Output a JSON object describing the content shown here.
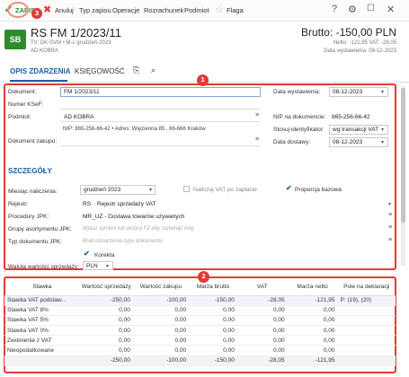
{
  "toolbar": {
    "save": "ZAPISZ",
    "cancel": "Anuluj",
    "type": "Typ zapisu",
    "operations": "Operacje",
    "settlement": "Rozrachunek",
    "subject": "Podmiot",
    "flag": "Flaga",
    "help": "?",
    "markers": {
      "one": "1",
      "two": "2",
      "three": "3"
    }
  },
  "header": {
    "badge": "SB",
    "title": "RS FM 1/2023/11",
    "sub1": "TV: DK-SVM  •  M-c grudzień-2023",
    "sub2": "AD KOBRA",
    "brutto": "Brutto: -150,00 PLN",
    "netto_vat": "Netto: -121,95 VAT: -28,05",
    "issue_date": "Data wystawienia: 08-12-2023"
  },
  "tabs": {
    "opis": "OPIS ZDARZENIA",
    "ksiegowosc": "KSIĘGOWOŚĆ"
  },
  "form": {
    "dokument_label": "Dokument:",
    "dokument_value": "FM 1/2023/11",
    "ksef_label": "Numer KSeF:",
    "podmiot_label": "Podmiot:",
    "podmiot_value": "AD KOBRA",
    "nip_line": "NIP: 865-256-66-42  •  Adres: Więzienna 85 , 66-666 Kraków",
    "dok_zakupu_label": "Dokument zakupu:",
    "data_wyst_label": "Data wystawienia:",
    "data_wyst_value": "08-12-2023",
    "nip_dok_label": "NIP na dokumencie:",
    "nip_dok_value": "865-256-66-42",
    "stosuj_label": "Stosuj identyfikator:",
    "stosuj_value": "wg transakcji VAT",
    "data_dost_label": "Data dostawy:",
    "data_dost_value": "08-12-2023"
  },
  "details": {
    "title": "SZCZEGÓŁY",
    "miesiac_label": "Miesiąc naliczenia:",
    "miesiac_value": "grudzień 2023",
    "vat_po_zaplacie": "Naliczaj VAT po zapłacie",
    "proporcja": "Proporcja bazowa",
    "rejestr_label": "Rejestr:",
    "rejestr_code": "RS",
    "rejestr_value": "Rejestr sprzedaży VAT",
    "procedury_label": "Procedury JPK:",
    "procedury_value": "MR_UZ - Dostawa towarów używanych",
    "grupy_label": "Grupy asortymentu JPK:",
    "grupy_placeholder": "Wpisz symbol lub wciśnij F2 aby rozwinąć listę",
    "typ_label": "Typ dokumentu JPK:",
    "typ_placeholder": "Brak oznaczenia typu dokumentu",
    "korekta": "Korekta",
    "waluta_label": "Waluta wartości sprzedaży:",
    "waluta_value": "PLN"
  },
  "table": {
    "headers": [
      "Stawka",
      "Wartość sprzedaży",
      "Wartość zakupu",
      "Marża brutto",
      "VAT",
      "Marża netto",
      "Pole na deklaracji"
    ],
    "rows": [
      [
        "Stawka VAT podstaw...",
        "-250,00",
        "-100,00",
        "-150,00",
        "-28,05",
        "-121,95",
        "P: (19), (20)"
      ],
      [
        "Stawka VAT 8%",
        "0,00",
        "0,00",
        "0,00",
        "0,00",
        "0,00",
        ""
      ],
      [
        "Stawka VAT 5%",
        "0,00",
        "0,00",
        "0,00",
        "0,00",
        "0,00",
        ""
      ],
      [
        "Stawka VAT 0%",
        "0,00",
        "0,00",
        "0,00",
        "0,00",
        "0,00",
        ""
      ],
      [
        "Zwolnienie z VAT",
        "0,00",
        "0,00",
        "0,00",
        "0,00",
        "0,00",
        ""
      ],
      [
        "Nieopodatkowane",
        "0,00",
        "0,00",
        "0,00",
        "0,00",
        "0,00",
        ""
      ]
    ],
    "totals": [
      "",
      "-250,00",
      "-100,00",
      "-150,00",
      "-28,05",
      "-121,95",
      ""
    ]
  },
  "colors": {
    "accent": "#1a5fa8",
    "save": "#2e8b2e",
    "marker": "#e53935"
  }
}
